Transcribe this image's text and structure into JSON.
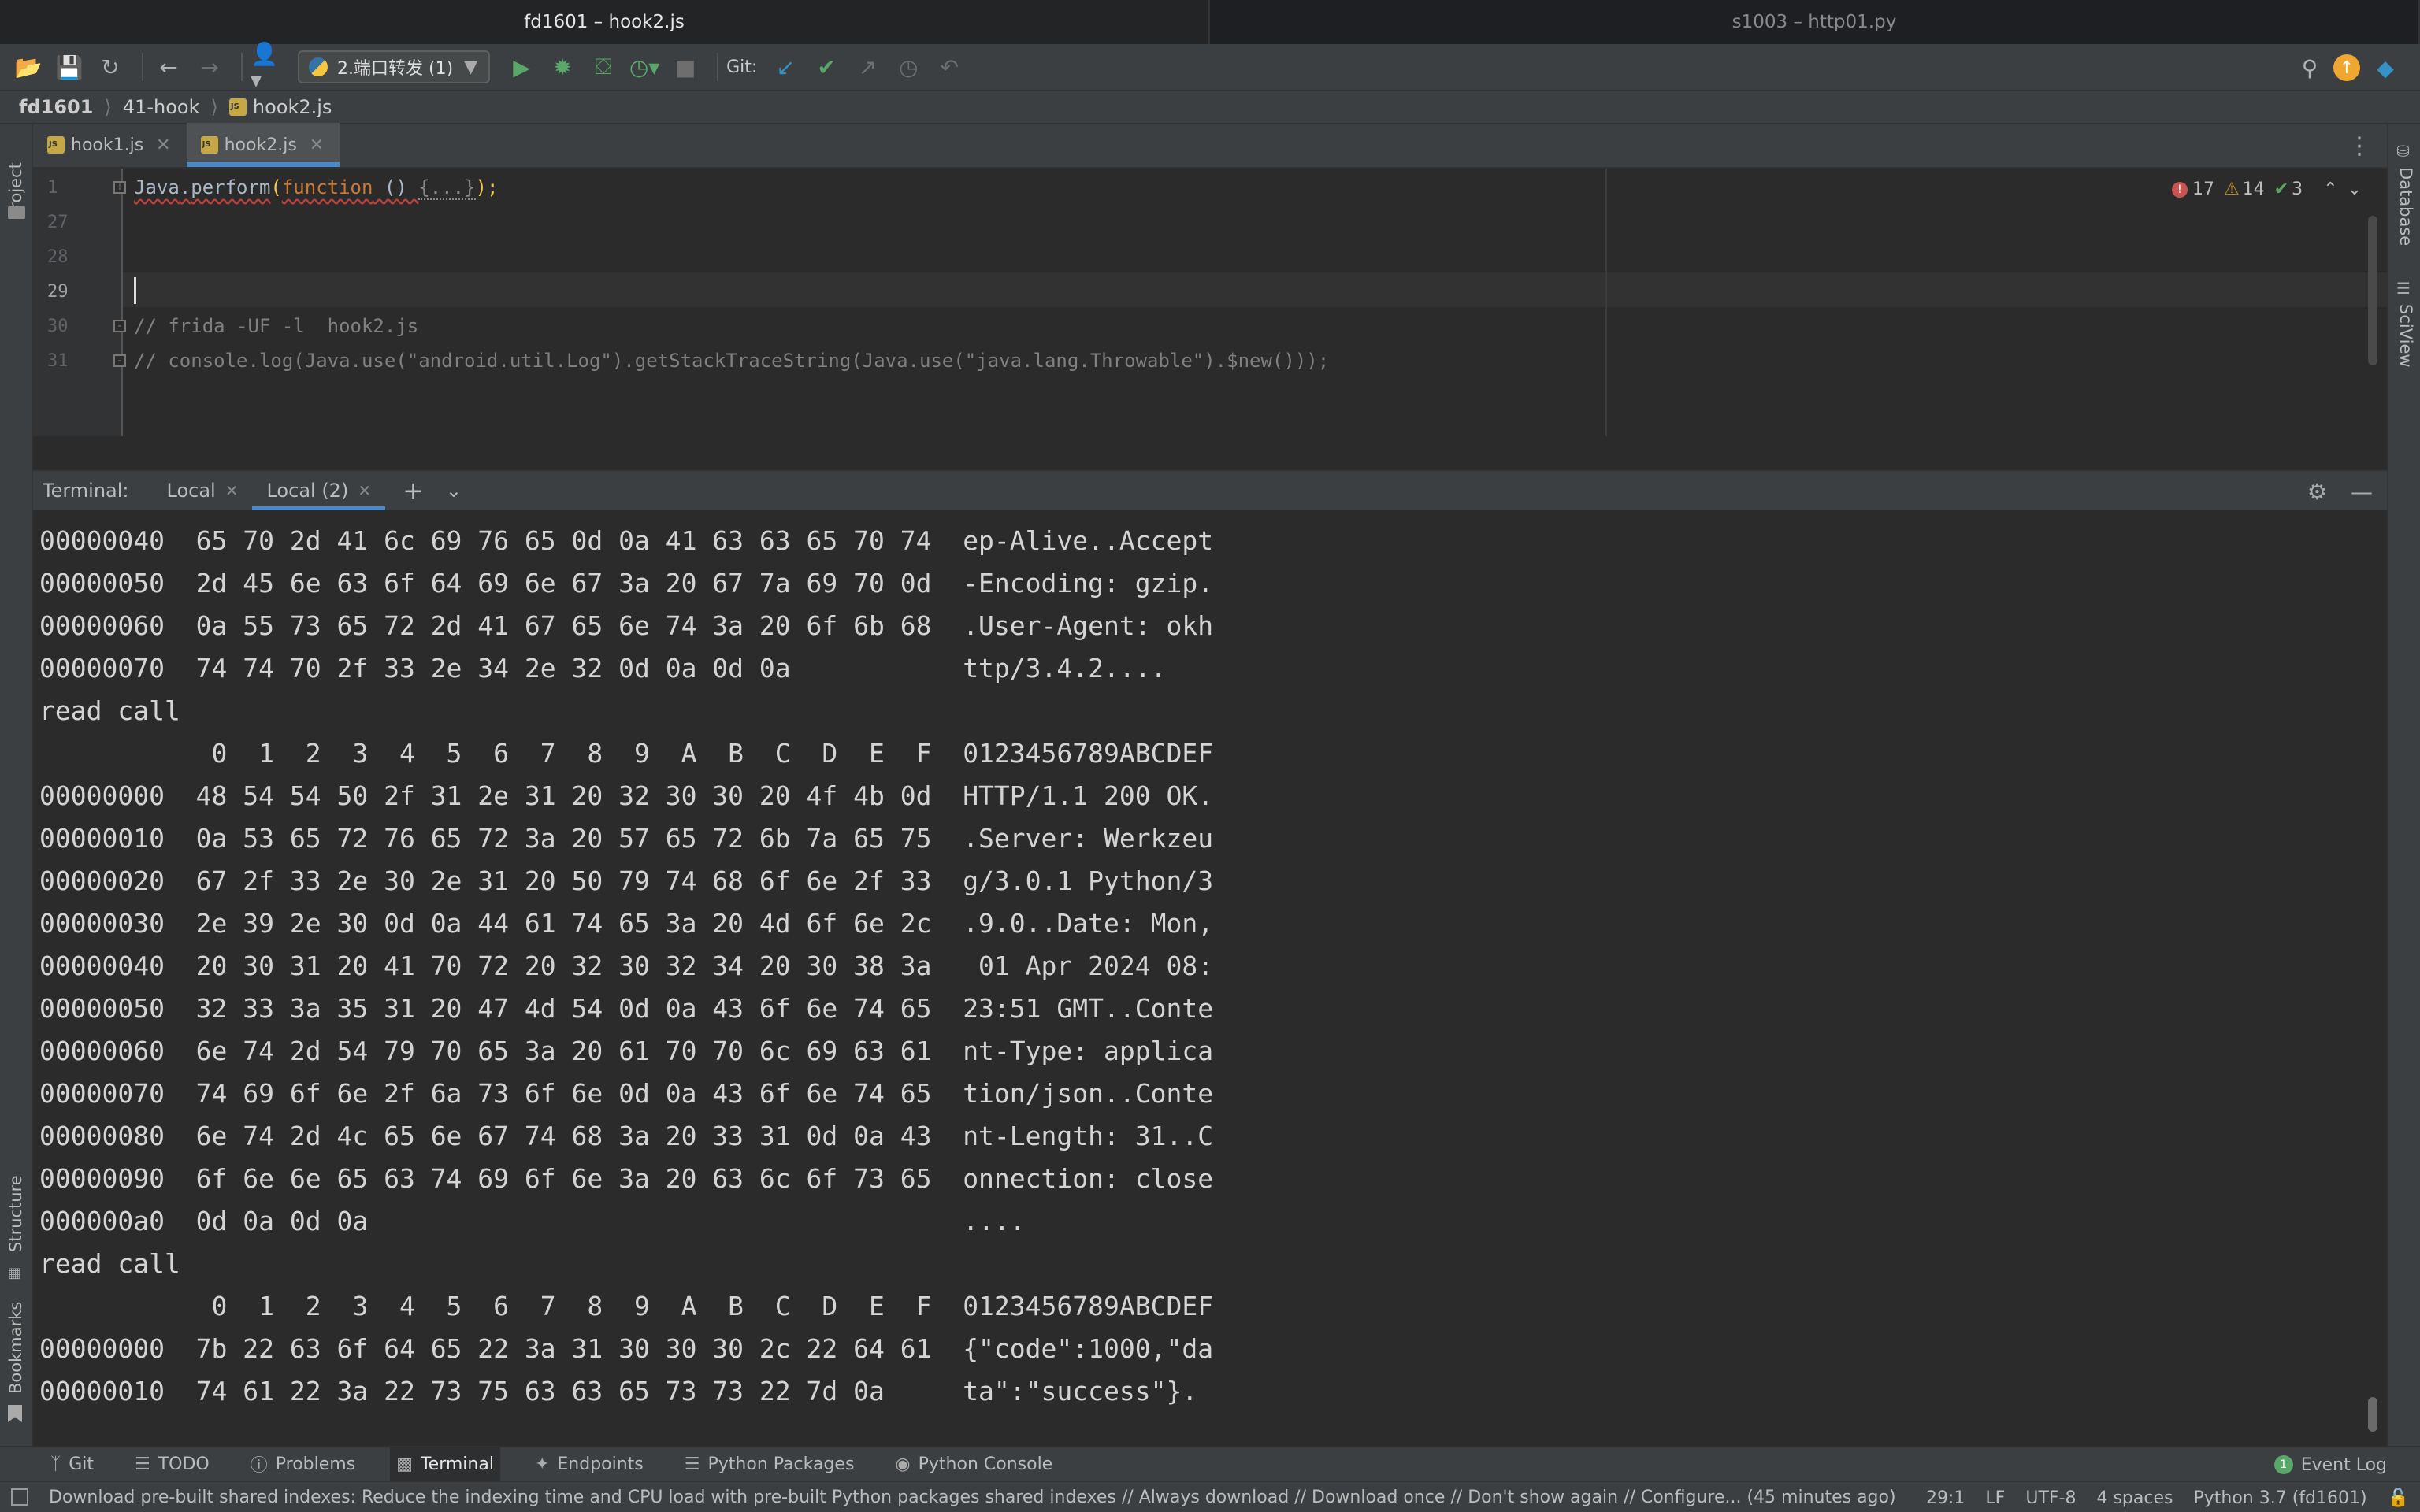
{
  "window_tabs": [
    "fd1601 – hook2.js",
    "s1003 – http01.py"
  ],
  "toolbar": {
    "run_config": "2.端口转发 (1)",
    "git_label": "Git:"
  },
  "breadcrumb": [
    "fd1601",
    "41-hook",
    "hook2.js"
  ],
  "left_tool_labels": {
    "project": "Project",
    "structure": "Structure",
    "bookmarks": "Bookmarks"
  },
  "right_tool_labels": {
    "database": "Database",
    "sciview": "SciView"
  },
  "editor": {
    "tabs": [
      {
        "label": "hook1.js",
        "active": false
      },
      {
        "label": "hook2.js",
        "active": true
      }
    ],
    "inspections": {
      "errors": "17",
      "warnings": "14",
      "ok": "3"
    },
    "line_numbers": [
      "1",
      "27",
      "28",
      "29",
      "30",
      "31"
    ],
    "line1": {
      "obj": "Java",
      "dot": ".",
      "method": "perform",
      "open": "(",
      "kw": "function",
      "sig": " () ",
      "folded": "{...}",
      "close": ");"
    },
    "line30": "// frida -UF -l  hook2.js",
    "line31": "// console.log(Java.use(\"android.util.Log\").getStackTraceString(Java.use(\"java.lang.Throwable\").$new()));"
  },
  "terminal": {
    "label": "Terminal:",
    "tabs": [
      {
        "label": "Local",
        "active": false
      },
      {
        "label": "Local (2)",
        "active": true
      }
    ],
    "lines": [
      "00000040  65 70 2d 41 6c 69 76 65 0d 0a 41 63 63 65 70 74  ep-Alive..Accept",
      "00000050  2d 45 6e 63 6f 64 69 6e 67 3a 20 67 7a 69 70 0d  -Encoding: gzip.",
      "00000060  0a 55 73 65 72 2d 41 67 65 6e 74 3a 20 6f 6b 68  .User-Agent: okh",
      "00000070  74 74 70 2f 33 2e 34 2e 32 0d 0a 0d 0a           ttp/3.4.2....",
      "read call",
      "           0  1  2  3  4  5  6  7  8  9  A  B  C  D  E  F  0123456789ABCDEF",
      "00000000  48 54 54 50 2f 31 2e 31 20 32 30 30 20 4f 4b 0d  HTTP/1.1 200 OK.",
      "00000010  0a 53 65 72 76 65 72 3a 20 57 65 72 6b 7a 65 75  .Server: Werkzeu",
      "00000020  67 2f 33 2e 30 2e 31 20 50 79 74 68 6f 6e 2f 33  g/3.0.1 Python/3",
      "00000030  2e 39 2e 30 0d 0a 44 61 74 65 3a 20 4d 6f 6e 2c  .9.0..Date: Mon,",
      "00000040  20 30 31 20 41 70 72 20 32 30 32 34 20 30 38 3a   01 Apr 2024 08:",
      "00000050  32 33 3a 35 31 20 47 4d 54 0d 0a 43 6f 6e 74 65  23:51 GMT..Conte",
      "00000060  6e 74 2d 54 79 70 65 3a 20 61 70 70 6c 69 63 61  nt-Type: applica",
      "00000070  74 69 6f 6e 2f 6a 73 6f 6e 0d 0a 43 6f 6e 74 65  tion/json..Conte",
      "00000080  6e 74 2d 4c 65 6e 67 74 68 3a 20 33 31 0d 0a 43  nt-Length: 31..C",
      "00000090  6f 6e 6e 65 63 74 69 6f 6e 3a 20 63 6c 6f 73 65  onnection: close",
      "000000a0  0d 0a 0d 0a                                      ....",
      "read call",
      "           0  1  2  3  4  5  6  7  8  9  A  B  C  D  E  F  0123456789ABCDEF",
      "00000000  7b 22 63 6f 64 65 22 3a 31 30 30 30 2c 22 64 61  {\"code\":1000,\"da",
      "00000010  74 61 22 3a 22 73 75 63 63 65 73 73 22 7d 0a     ta\":\"success\"}."
    ]
  },
  "tool_windows": [
    "Git",
    "TODO",
    "Problems",
    "Terminal",
    "Endpoints",
    "Python Packages",
    "Python Console"
  ],
  "event_log": {
    "label": "Event Log",
    "count": "1"
  },
  "status": {
    "message": "Download pre-built shared indexes: Reduce the indexing time and CPU load with pre-built Python packages shared indexes // Always download // Download once // Don't show again // Configure... (45 minutes ago)",
    "position": "29:1",
    "line_sep": "LF",
    "encoding": "UTF-8",
    "indent": "4 spaces",
    "interpreter": "Python 3.7 (fd1601)"
  }
}
